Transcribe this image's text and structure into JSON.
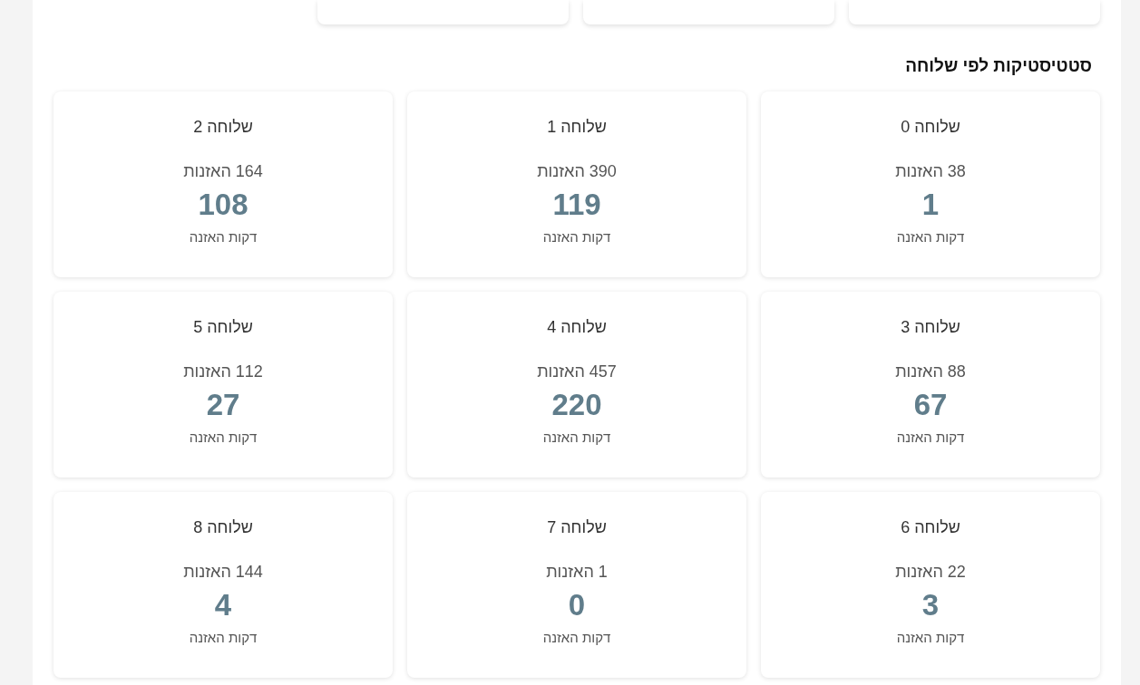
{
  "section_title": "סטטיסטיקות לפי שלוחה",
  "extensions": [
    {
      "name": "שלוחה 0",
      "listens": "38 האזנות",
      "minutes": "1",
      "minutes_label": "דקות האזנה"
    },
    {
      "name": "שלוחה 1",
      "listens": "390 האזנות",
      "minutes": "119",
      "minutes_label": "דקות האזנה"
    },
    {
      "name": "שלוחה 2",
      "listens": "164 האזנות",
      "minutes": "108",
      "minutes_label": "דקות האזנה"
    },
    {
      "name": "שלוחה 3",
      "listens": "88 האזנות",
      "minutes": "67",
      "minutes_label": "דקות האזנה"
    },
    {
      "name": "שלוחה 4",
      "listens": "457 האזנות",
      "minutes": "220",
      "minutes_label": "דקות האזנה"
    },
    {
      "name": "שלוחה 5",
      "listens": "112 האזנות",
      "minutes": "27",
      "minutes_label": "דקות האזנה"
    },
    {
      "name": "שלוחה 6",
      "listens": "22 האזנות",
      "minutes": "3",
      "minutes_label": "דקות האזנה"
    },
    {
      "name": "שלוחה 7",
      "listens": "1 האזנות",
      "minutes": "0",
      "minutes_label": "דקות האזנה"
    },
    {
      "name": "שלוחה 8",
      "listens": "144 האזנות",
      "minutes": "4",
      "minutes_label": "דקות האזנה"
    }
  ]
}
